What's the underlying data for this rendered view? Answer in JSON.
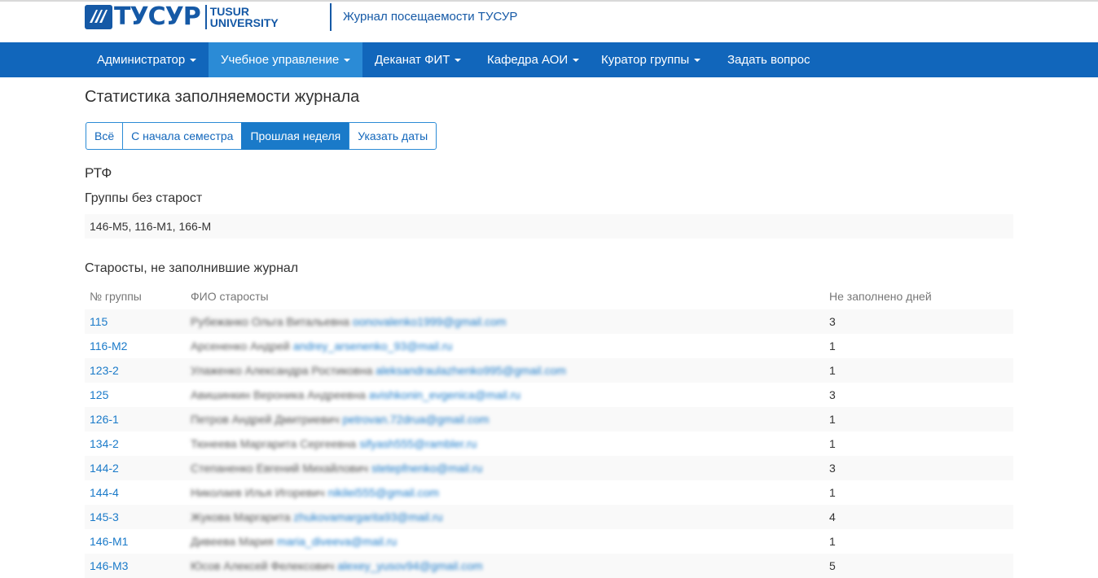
{
  "header": {
    "logo_text": "ТУСУР",
    "logo_en_line1": "TUSUR",
    "logo_en_line2": "UNIVERSITY",
    "site_title": "Журнал посещаемости ТУСУР",
    "brand_color": "#1559a6"
  },
  "navbar": {
    "items": [
      {
        "label": "Администратор"
      },
      {
        "label": "Учебное управление"
      },
      {
        "label": "Деканат ФИТ"
      },
      {
        "label": "Кафедра АОИ"
      },
      {
        "label": "Куратор группы"
      },
      {
        "label": "Задать вопрос"
      }
    ],
    "active": "Учебное управление",
    "bg_color": "#1166bb"
  },
  "page": {
    "title": "Статистика заполняемости журнала",
    "filters": [
      "Всё",
      "С начала семестра",
      "Прошлая неделя",
      "Указать даты"
    ],
    "active_filter": "Прошлая неделя",
    "faculty": "РТФ",
    "groups_without_heads_title": "Группы без старост",
    "groups_without_heads": "146-М5, 116-М1, 166-М",
    "heads_title": "Старосты, не заполнившие журнал"
  },
  "table": {
    "headers": [
      "№ группы",
      "ФИО старосты",
      "Не заполнено дней"
    ],
    "rows": [
      {
        "group": "115",
        "fio": "Рубежанко Ольга Витальевна",
        "email": "oonovalenko1999@gmail.com",
        "days": "3"
      },
      {
        "group": "116-М2",
        "fio": "Арсененко Андрей",
        "email": "andrey_arsenenko_93@mail.ru",
        "days": "1"
      },
      {
        "group": "123-2",
        "fio": "Улаженко Александра Ростиковна",
        "email": "aleksandraulazhenko995@gmail.com",
        "days": "1"
      },
      {
        "group": "125",
        "fio": "Авишинкин Вероника Андреевна",
        "email": "avishkonin_evgenica@mail.ru",
        "days": "3"
      },
      {
        "group": "126-1",
        "fio": "Петров Андрей Дмитриевич",
        "email": "petrovan.72drua@gmail.com",
        "days": "1"
      },
      {
        "group": "134-2",
        "fio": "Тюнеева Маргарита Сергеевна",
        "email": "sifyash555@rambler.ru",
        "days": "1"
      },
      {
        "group": "144-2",
        "fio": "Степаненко Евгений Михайлович",
        "email": "stetepfnenko@mail.ru",
        "days": "3"
      },
      {
        "group": "144-4",
        "fio": "Николаев Илья Игоревич",
        "email": "nikilei555@gmail.com",
        "days": "1"
      },
      {
        "group": "145-3",
        "fio": "Жукова Маргарита",
        "email": "zhukovamargarita93@mail.ru",
        "days": "4"
      },
      {
        "group": "146-М1",
        "fio": "Дивеева Мария",
        "email": "maria_diveeva@mail.ru",
        "days": "1"
      },
      {
        "group": "146-М3",
        "fio": "Юсов Алексей Фелексович",
        "email": "alexey_yusov94@gmail.com",
        "days": "5"
      }
    ]
  }
}
